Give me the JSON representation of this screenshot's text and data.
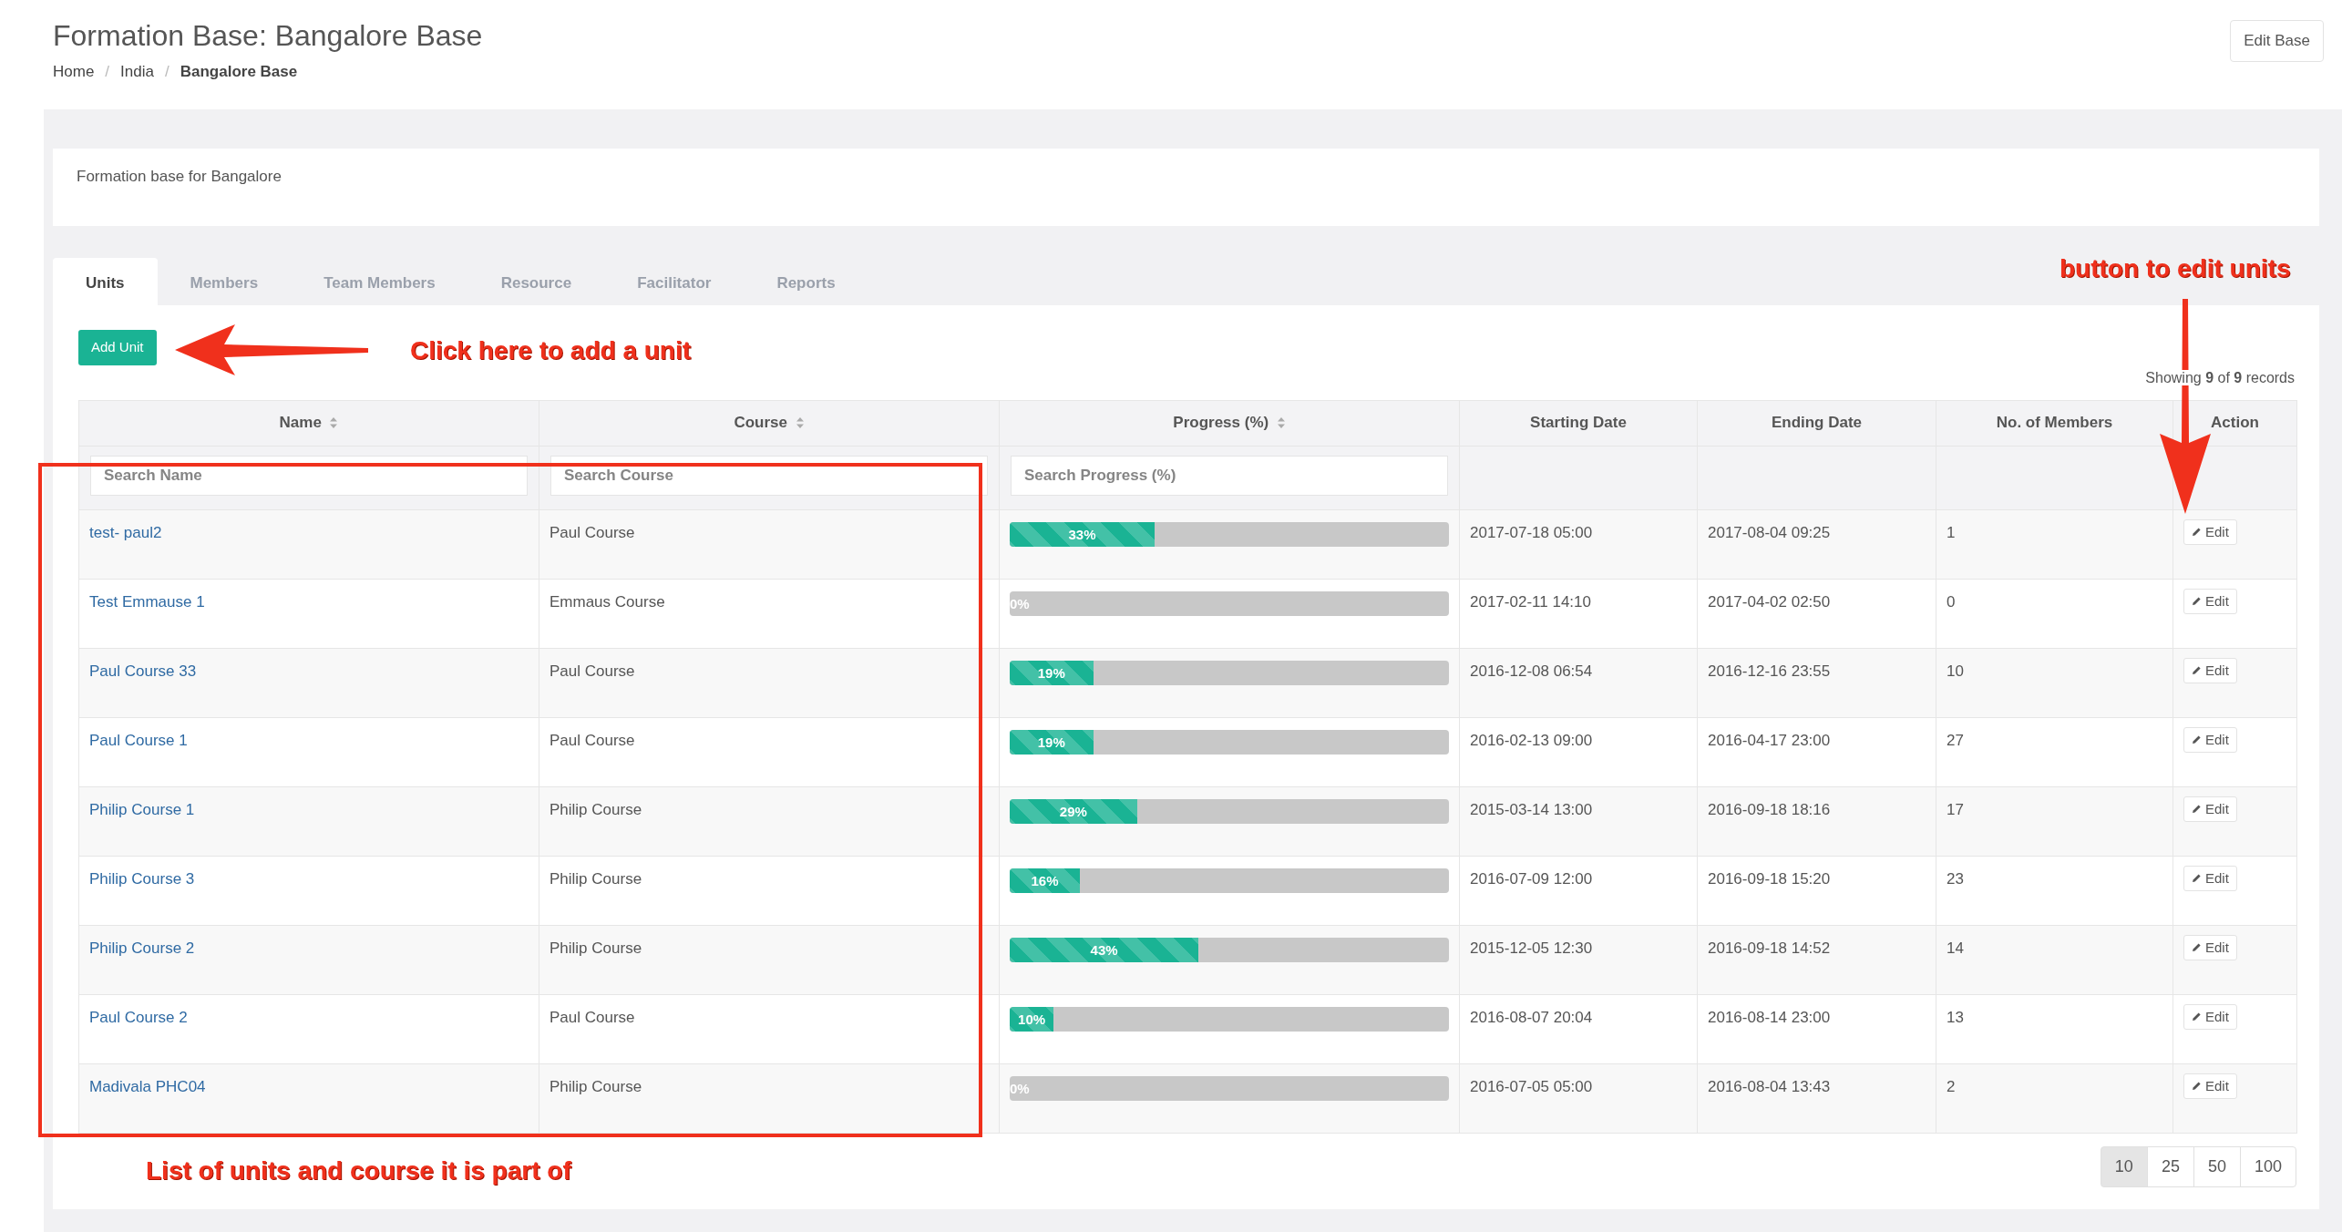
{
  "header": {
    "title": "Formation Base: Bangalore Base",
    "breadcrumb": [
      {
        "label": "Home",
        "current": false
      },
      {
        "separator": "/",
        "label": "India",
        "current": false
      },
      {
        "separator": "/",
        "label": "Bangalore Base",
        "current": true
      }
    ],
    "edit_button": "Edit Base"
  },
  "description": "Formation base for Bangalore",
  "tabs": [
    {
      "label": "Units",
      "selected": true
    },
    {
      "label": "Members",
      "selected": false
    },
    {
      "label": "Team Members",
      "selected": false
    },
    {
      "label": "Resource",
      "selected": false
    },
    {
      "label": "Facilitator",
      "selected": false
    },
    {
      "label": "Reports",
      "selected": false
    }
  ],
  "add_button": "Add Unit",
  "records_info": "Showing **9** of **9** records",
  "table": {
    "columns": [
      {
        "label": "Name",
        "sortable": true
      },
      {
        "label": "Course",
        "sortable": true
      },
      {
        "label": "Progress (%)",
        "sortable": true
      },
      {
        "label": "Starting Date",
        "sortable": false
      },
      {
        "label": "Ending Date",
        "sortable": false
      },
      {
        "label": "No. of Members",
        "sortable": false
      },
      {
        "label": "Action",
        "sortable": false
      }
    ],
    "filters": [
      {
        "placeholder": "Search Name"
      },
      {
        "placeholder": "Search Course"
      },
      {
        "placeholder": "Search Progress (%)"
      }
    ],
    "rows": [
      {
        "name": "test- paul2",
        "course": "Paul Course",
        "progress": {
          "level": 0.33,
          "reading": "33%"
        },
        "start": "2017-07-18 05:00",
        "end": "2017-08-04 09:25",
        "members": "1",
        "action": "Edit"
      },
      {
        "name": "Test Emmause 1",
        "course": "Emmaus Course",
        "progress": {
          "level": 0,
          "reading": "0%"
        },
        "start": "2017-02-11 14:10",
        "end": "2017-04-02 02:50",
        "members": "0",
        "action": "Edit"
      },
      {
        "name": "Paul Course 33",
        "course": "Paul Course",
        "progress": {
          "level": 0.19,
          "reading": "19%"
        },
        "start": "2016-12-08 06:54",
        "end": "2016-12-16 23:55",
        "members": "10",
        "action": "Edit"
      },
      {
        "name": "Paul Course 1",
        "course": "Paul Course",
        "progress": {
          "level": 0.19,
          "reading": "19%"
        },
        "start": "2016-02-13 09:00",
        "end": "2016-04-17 23:00",
        "members": "27",
        "action": "Edit"
      },
      {
        "name": "Philip Course 1",
        "course": "Philip Course",
        "progress": {
          "level": 0.29,
          "reading": "29%"
        },
        "start": "2015-03-14 13:00",
        "end": "2016-09-18 18:16",
        "members": "17",
        "action": "Edit"
      },
      {
        "name": "Philip Course 3",
        "course": "Philip Course",
        "progress": {
          "level": 0.16,
          "reading": "16%"
        },
        "start": "2016-07-09 12:00",
        "end": "2016-09-18 15:20",
        "members": "23",
        "action": "Edit"
      },
      {
        "name": "Philip Course 2",
        "course": "Philip Course",
        "progress": {
          "level": 0.43,
          "reading": "43%"
        },
        "start": "2015-12-05 12:30",
        "end": "2016-09-18 14:52",
        "members": "14",
        "action": "Edit"
      },
      {
        "name": "Paul Course 2",
        "course": "Paul Course",
        "progress": {
          "level": 0.1,
          "reading": "10%"
        },
        "start": "2016-08-07 20:04",
        "end": "2016-08-14 23:00",
        "members": "13",
        "action": "Edit"
      },
      {
        "name": "Madivala PHC04",
        "course": "Philip Course",
        "progress": {
          "level": 0,
          "reading": "0%"
        },
        "start": "2016-07-05 05:00",
        "end": "2016-08-04 13:43",
        "members": "2",
        "action": "Edit"
      }
    ]
  },
  "page_sizes": [
    {
      "label": "10",
      "selected": true
    },
    {
      "label": "25",
      "selected": false
    },
    {
      "label": "50",
      "selected": false
    },
    {
      "label": "100",
      "selected": false
    }
  ],
  "annotations": [
    {
      "kind": "left-arrow",
      "text": "Click here to add a unit"
    },
    {
      "kind": "down-arrow",
      "text": "button to edit units"
    },
    {
      "kind": "frame",
      "text": "List of units and course it is part of"
    }
  ]
}
